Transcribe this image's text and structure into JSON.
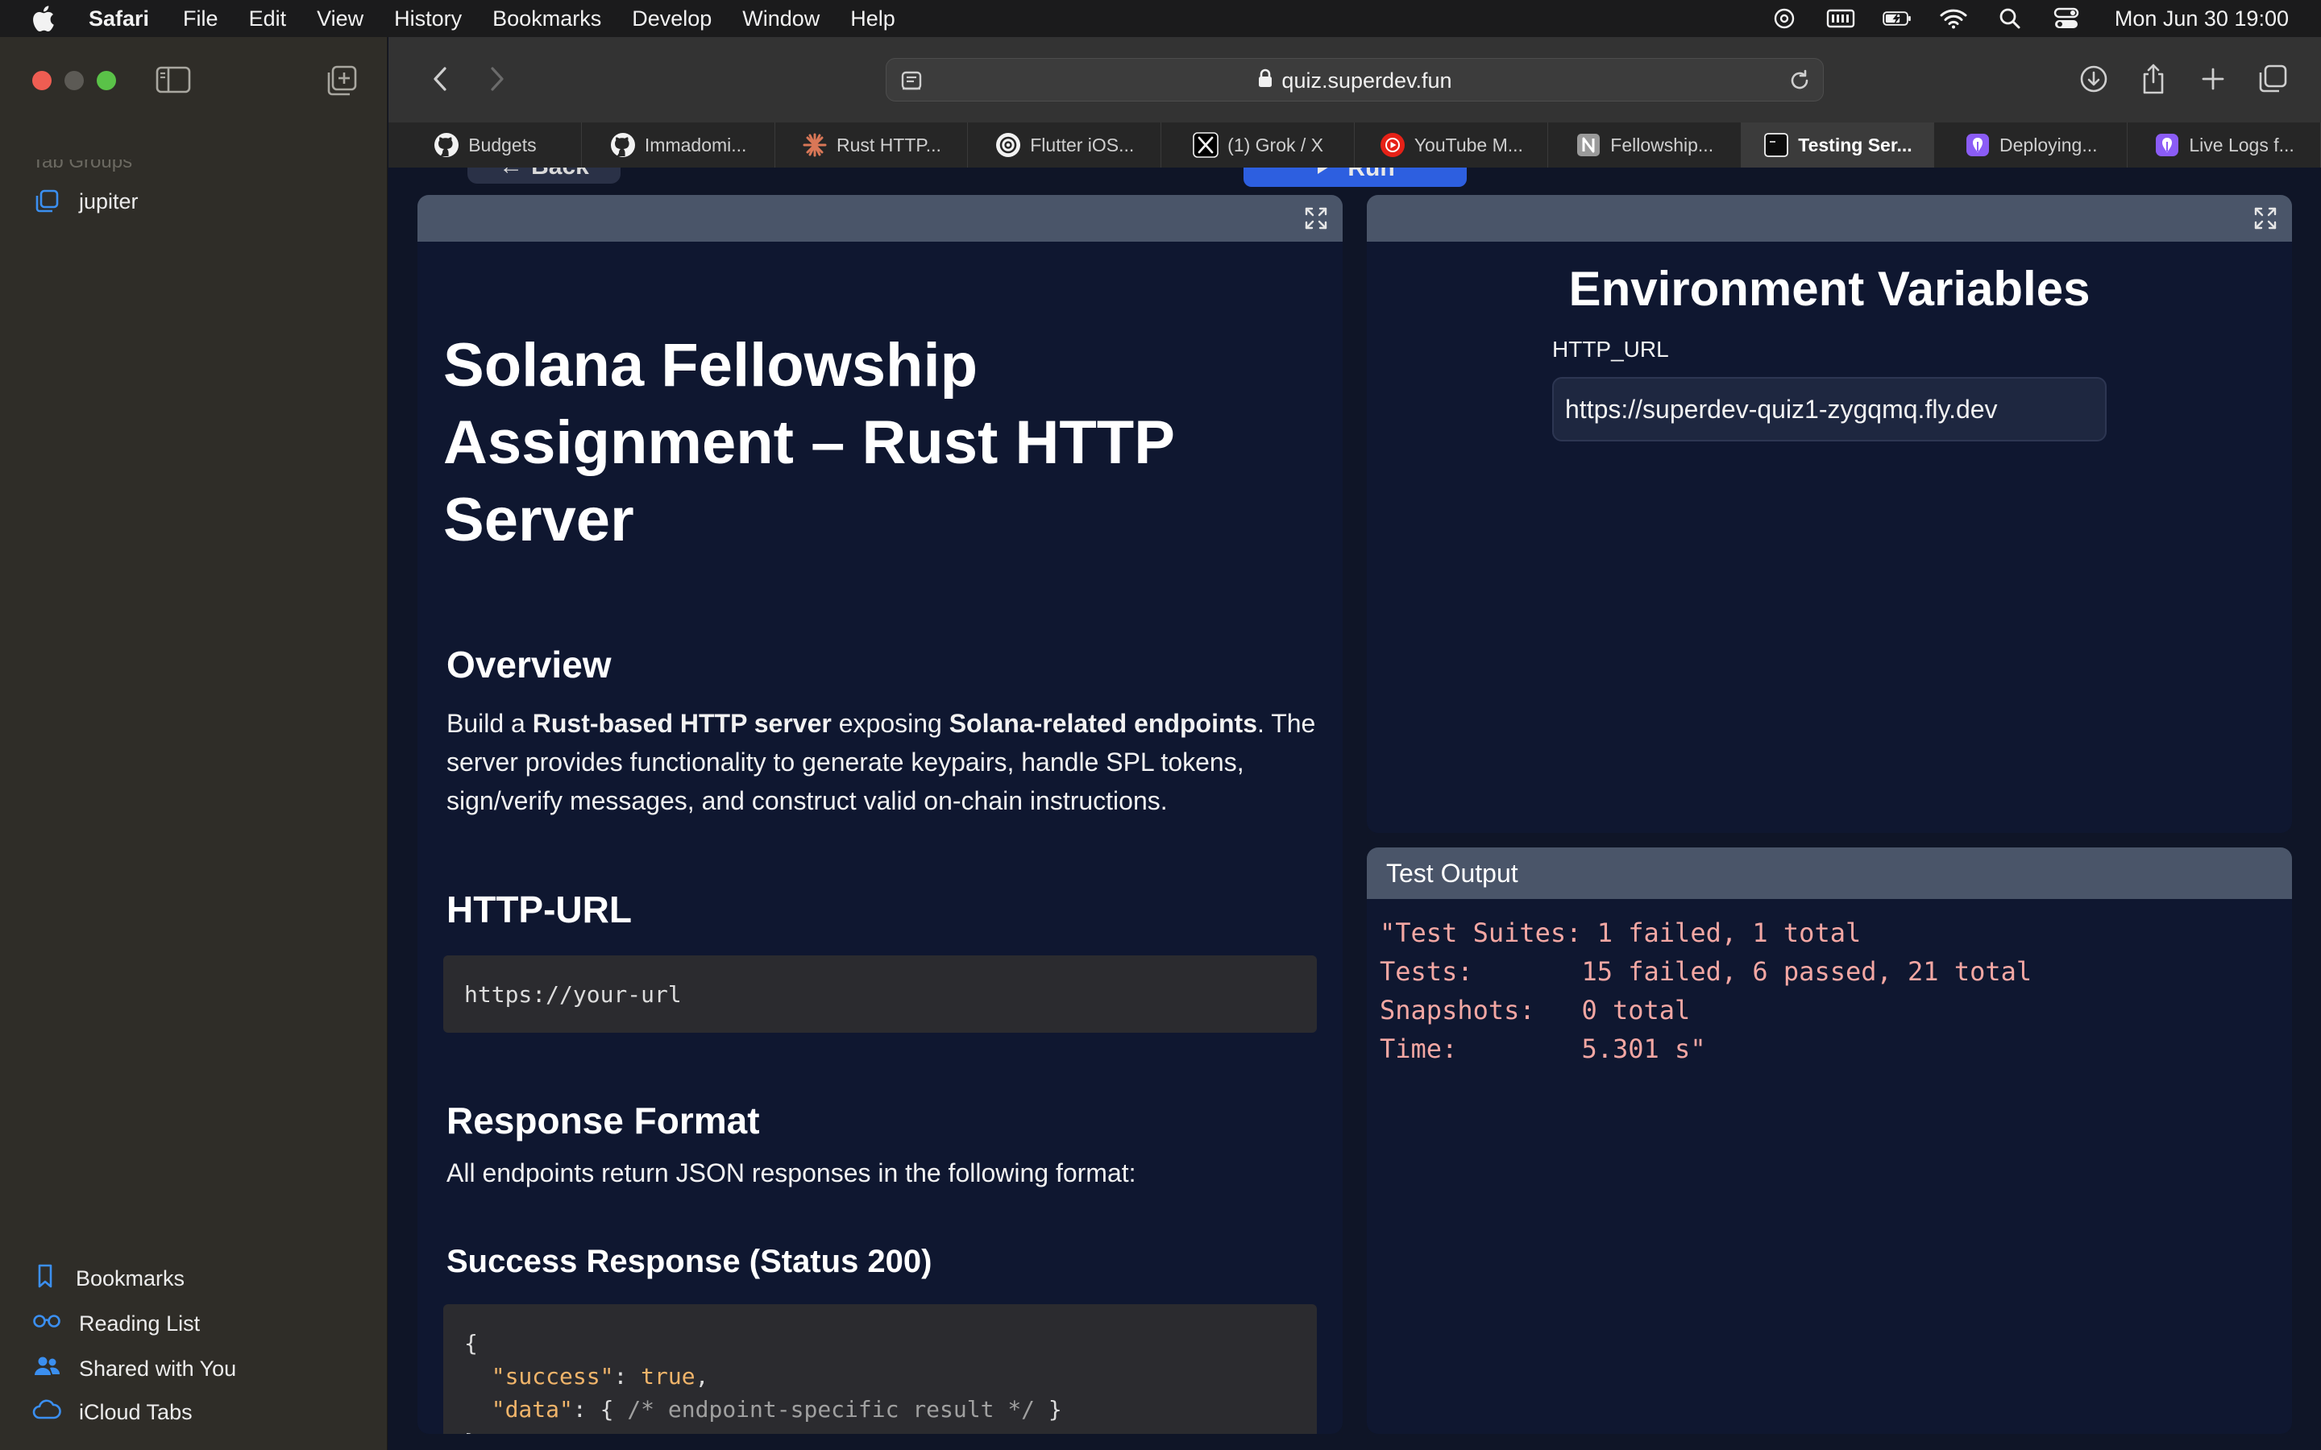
{
  "menubar": {
    "app_name": "Safari",
    "items": [
      "File",
      "Edit",
      "View",
      "History",
      "Bookmarks",
      "Develop",
      "Window",
      "Help"
    ],
    "clock": "Mon Jun 30  19:00"
  },
  "sidebar": {
    "tab_groups_label": "Tab Groups",
    "group_name": "jupiter",
    "bottom_items": [
      "Bookmarks",
      "Reading List",
      "Shared with You",
      "iCloud Tabs"
    ]
  },
  "toolbar": {
    "url": "quiz.superdev.fun"
  },
  "tabs": [
    {
      "label": "Budgets",
      "icon": "github-icon"
    },
    {
      "label": "Immadomi...",
      "icon": "github-icon"
    },
    {
      "label": "Rust HTTP...",
      "icon": "claude-icon"
    },
    {
      "label": "Flutter iOS...",
      "icon": "chatgpt-icon"
    },
    {
      "label": "(1) Grok / X",
      "icon": "x-icon"
    },
    {
      "label": "YouTube M...",
      "icon": "youtube-icon"
    },
    {
      "label": "Fellowship...",
      "icon": "notion-icon"
    },
    {
      "label": "Testing Ser...",
      "icon": "site-icon",
      "active": true
    },
    {
      "label": "Deploying...",
      "icon": "flyio-icon"
    },
    {
      "label": "Live Logs f...",
      "icon": "flyio-icon"
    }
  ],
  "page": {
    "back_label": "Back",
    "run_label": "Run",
    "doc": {
      "title": "Solana Fellowship Assignment – Rust HTTP Server",
      "overview_heading": "Overview",
      "overview_p1_pre": "Build a ",
      "overview_p1_b1": "Rust-based HTTP server",
      "overview_p1_mid": " exposing ",
      "overview_p1_b2": "Solana-related endpoints",
      "overview_p1_post": ".",
      "overview_p2": "The server provides functionality to generate keypairs, handle SPL tokens, sign/verify messages, and construct valid on-chain instructions.",
      "http_heading": "HTTP-URL",
      "http_code": "https://your-url",
      "response_heading": "Response Format",
      "response_p": "All endpoints return JSON responses in the following format:",
      "success_heading": "Success Response (Status 200)",
      "json_open": "{",
      "json_success_key": "\"success\"",
      "json_success_val": "true",
      "json_data_key": "\"data\"",
      "json_data_open": "{ ",
      "json_data_comment": "/* endpoint-specific result */",
      "json_data_close": " }",
      "json_close": "}"
    },
    "env": {
      "title": "Environment Variables",
      "label": "HTTP_URL",
      "value": "https://superdev-quiz1-zygqmq.fly.dev"
    },
    "output": {
      "title": "Test Output",
      "lines": [
        "\"Test Suites: 1 failed, 1 total",
        "Tests:       15 failed, 6 passed, 21 total",
        "Snapshots:   0 total",
        "Time:        5.301 s\""
      ]
    }
  },
  "colors": {
    "accent_run": "#2d5fe0",
    "output_text": "#f4a7a3",
    "panel_header": "#4a5569"
  }
}
